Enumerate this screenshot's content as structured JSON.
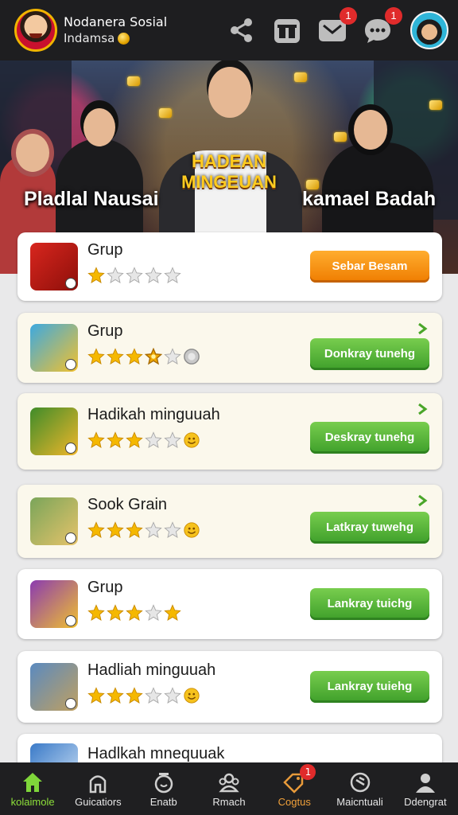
{
  "header": {
    "title": "Nodanera Sosial",
    "subtitle": "Indamsa",
    "message_badge": "1",
    "chat_badge": "1"
  },
  "hero": {
    "left_label": "Pladlal Nausai",
    "title": "HADEAN MINGEUAN",
    "right_label": "kamael Badah"
  },
  "list": [
    {
      "name": "Grup",
      "stars": [
        1,
        0,
        0,
        0,
        0
      ],
      "extra_icon": "none",
      "action": "Sebar Besam",
      "action_color": "#f08a10",
      "has_chevron": false
    },
    {
      "name": "Grup",
      "stars": [
        1,
        1,
        1,
        0.5,
        0
      ],
      "extra_icon": "coin",
      "action": "Donkray tunehg",
      "action_color": "#52b336",
      "has_chevron": true
    },
    {
      "name": "Hadikah minguuah",
      "stars": [
        1,
        1,
        1,
        0,
        0
      ],
      "extra_icon": "smiley",
      "action": "Deskray tunehg",
      "action_color": "#52b336",
      "has_chevron": true
    },
    {
      "name": "Sook Grain",
      "stars": [
        1,
        1,
        1,
        0,
        0
      ],
      "extra_icon": "smiley",
      "action": "Latkray tuwehg",
      "action_color": "#52b336",
      "has_chevron": true
    },
    {
      "name": "Grup",
      "stars": [
        1,
        1,
        1,
        0,
        1
      ],
      "extra_icon": "none",
      "action": "Lankray tuichg",
      "action_color": "#52b336",
      "has_chevron": false
    },
    {
      "name": "Hadliah minguuah",
      "stars": [
        1,
        1,
        1,
        0,
        0
      ],
      "extra_icon": "smiley",
      "action": "Lankray tuiehg",
      "action_color": "#52b336",
      "has_chevron": false
    },
    {
      "name": "Hadlkah mnequuak",
      "stars": [],
      "extra_icon": "none",
      "action": "",
      "action_color": "#52b336",
      "has_chevron": false
    }
  ],
  "bottom_nav": [
    {
      "label": "kolaimole",
      "icon": "home-icon",
      "state": "active"
    },
    {
      "label": "Guicatiors",
      "icon": "house-outline-icon",
      "state": "normal"
    },
    {
      "label": "Enatb",
      "icon": "timer-icon",
      "state": "normal"
    },
    {
      "label": "Rmach",
      "icon": "people-icon",
      "state": "normal"
    },
    {
      "label": "Cogtus",
      "icon": "tag-icon",
      "state": "alert",
      "badge": "1"
    },
    {
      "label": "Maicntuali",
      "icon": "refresh-circle-icon",
      "state": "normal"
    },
    {
      "label": "Ddengrat",
      "icon": "user-icon",
      "state": "normal"
    }
  ],
  "colors": {
    "header_bg": "#1e1e20",
    "nav_bg": "#1f1f21",
    "active_nav": "#8de03a",
    "alert_nav": "#f0a03a",
    "badge": "#e02b2b",
    "star_gold": "#f5b800"
  }
}
